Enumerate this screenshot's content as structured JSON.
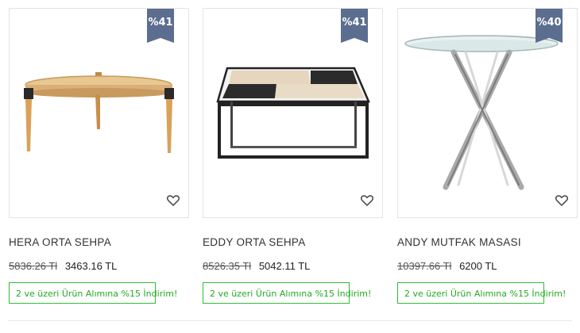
{
  "products": [
    {
      "badge": "%41",
      "name": "HERA ORTA SEHPA",
      "old_price": "5836.26 Tl",
      "new_price": "3463.16 TL",
      "promo": "2 ve üzeri Ürün Alımına %15 İndirim!",
      "illustration": "round-wooden-coffee-table"
    },
    {
      "badge": "%41",
      "name": "EDDY ORTA SEHPA",
      "old_price": "8526.35 Tl",
      "new_price": "5042.11 TL",
      "promo": "2 ve üzeri Ürün Alımına %15 İndirim!",
      "illustration": "square-metal-frame-coffee-table"
    },
    {
      "badge": "%40",
      "name": "ANDY MUTFAK MASASI",
      "old_price": "10397.66 Tl",
      "new_price": "6200 TL",
      "promo": "2 ve üzeri Ürün Alımına %15 İndirim!",
      "illustration": "round-glass-chrome-kitchen-table"
    }
  ],
  "icons": {
    "favorite": "heart-outline-icon"
  },
  "colors": {
    "badge": "#5c6e8f",
    "promo": "#22aa22"
  }
}
